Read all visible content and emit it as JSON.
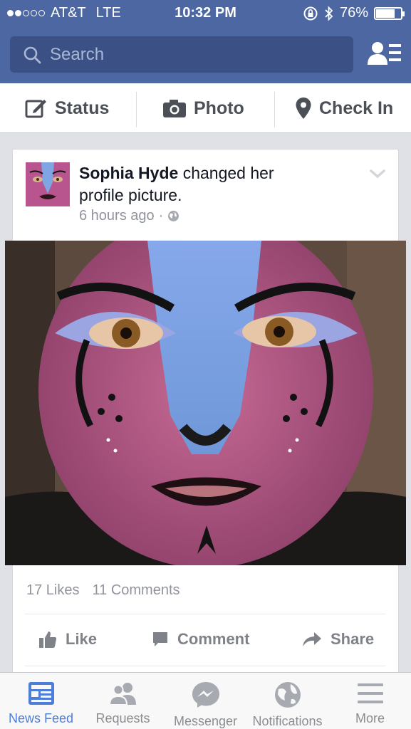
{
  "status_bar": {
    "carrier": "AT&T",
    "network": "LTE",
    "time": "10:32 PM",
    "battery": "76%",
    "battery_level": 0.76,
    "signal_bars_filled": 2,
    "signal_bars_total": 5
  },
  "search": {
    "placeholder": "Search"
  },
  "publisher": {
    "status_label": "Status",
    "photo_label": "Photo",
    "checkin_label": "Check In"
  },
  "story": {
    "author": "Sophia Hyde",
    "action": "changed her profile picture.",
    "time": "6 hours ago",
    "separator": "·",
    "likes": "17 Likes",
    "comments": "11 Comments",
    "like_label": "Like",
    "comment_label": "Comment",
    "share_label": "Share"
  },
  "tabs": [
    {
      "label": "News Feed",
      "icon": "news-feed-icon",
      "active": true
    },
    {
      "label": "Requests",
      "icon": "friend-requests-icon",
      "active": false
    },
    {
      "label": "Messenger",
      "icon": "messenger-icon",
      "active": false
    },
    {
      "label": "Notifications",
      "icon": "globe-icon",
      "active": false
    },
    {
      "label": "More",
      "icon": "menu-icon",
      "active": false
    }
  ],
  "colors": {
    "brand_blue": "#4c67a1",
    "search_bg": "#3b5186",
    "active_tab": "#4f7ed8",
    "muted_text": "#90949c"
  }
}
